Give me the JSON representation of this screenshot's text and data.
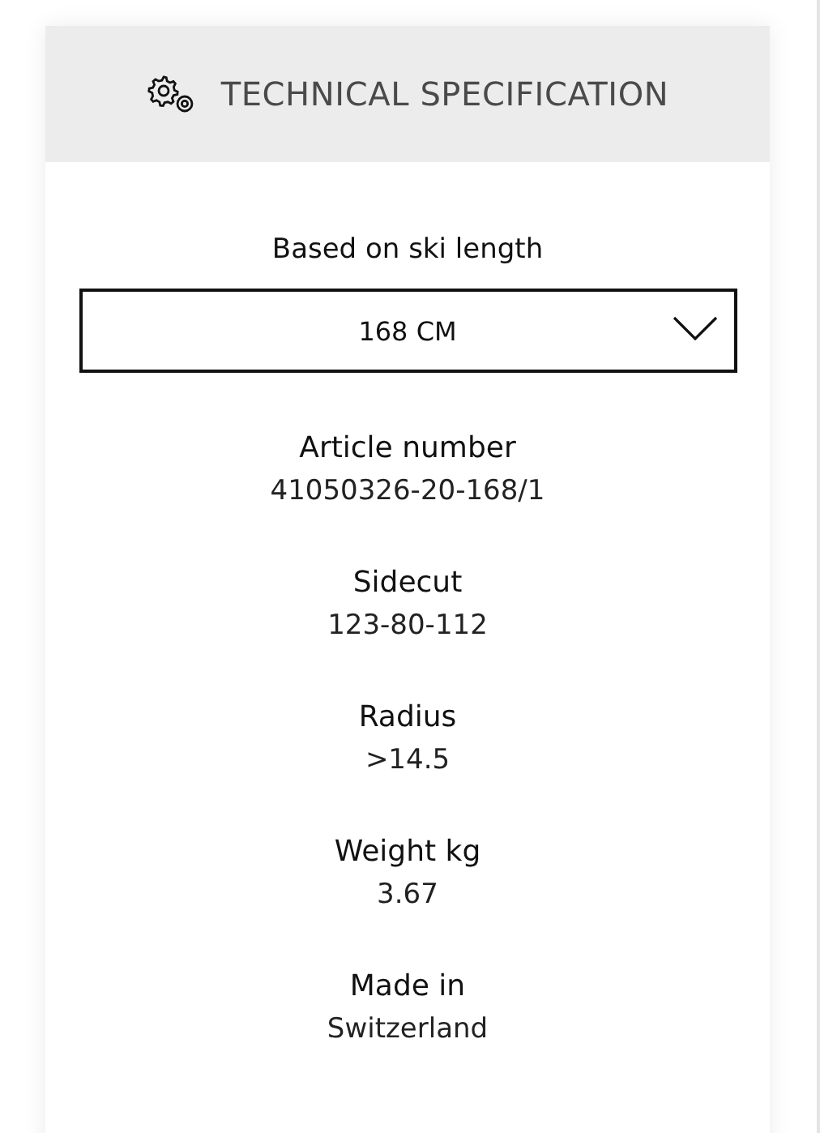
{
  "header": {
    "title": "TECHNICAL SPECIFICATION"
  },
  "length_select": {
    "label": "Based on ski length",
    "value": "168 CM"
  },
  "specs": [
    {
      "label": "Article number",
      "value": "41050326-20-168/1"
    },
    {
      "label": "Sidecut",
      "value": "123-80-112"
    },
    {
      "label": "Radius",
      "value": ">14.5"
    },
    {
      "label": "Weight kg",
      "value": "3.67"
    },
    {
      "label": "Made in",
      "value": "Switzerland"
    }
  ]
}
